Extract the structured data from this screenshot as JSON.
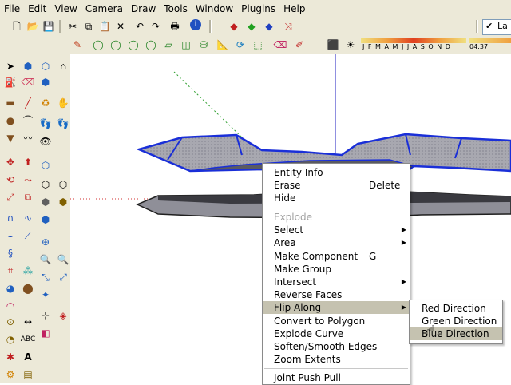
{
  "menu": [
    "File",
    "Edit",
    "View",
    "Camera",
    "Draw",
    "Tools",
    "Window",
    "Plugins",
    "Help"
  ],
  "layer": {
    "label": "La"
  },
  "shadow_months": "J F M A M J J A S O N D",
  "shadow_time": "04:37",
  "context_menu": {
    "items": [
      {
        "label": "Entity Info",
        "shortcut": "",
        "submenu": false,
        "disabled": false
      },
      {
        "label": "Erase",
        "shortcut": "Delete",
        "submenu": false,
        "disabled": false
      },
      {
        "label": "Hide",
        "shortcut": "",
        "submenu": false,
        "disabled": false
      },
      {
        "label": "Explode",
        "shortcut": "",
        "submenu": false,
        "disabled": true
      },
      {
        "label": "Select",
        "shortcut": "",
        "submenu": true,
        "disabled": false
      },
      {
        "label": "Area",
        "shortcut": "",
        "submenu": true,
        "disabled": false
      },
      {
        "label": "Make Component",
        "shortcut": "G",
        "submenu": false,
        "disabled": false
      },
      {
        "label": "Make Group",
        "shortcut": "",
        "submenu": false,
        "disabled": false
      },
      {
        "label": "Intersect",
        "shortcut": "",
        "submenu": true,
        "disabled": false
      },
      {
        "label": "Reverse Faces",
        "shortcut": "",
        "submenu": false,
        "disabled": false
      },
      {
        "label": "Flip Along",
        "shortcut": "",
        "submenu": true,
        "disabled": false,
        "highlighted": true
      },
      {
        "label": "Convert to Polygon",
        "shortcut": "",
        "submenu": false,
        "disabled": false
      },
      {
        "label": "Explode Curve",
        "shortcut": "",
        "submenu": false,
        "disabled": false
      },
      {
        "label": "Soften/Smooth Edges",
        "shortcut": "",
        "submenu": false,
        "disabled": false
      },
      {
        "label": "Zoom Extents",
        "shortcut": "",
        "submenu": false,
        "disabled": false
      },
      {
        "label": "Joint Push Pull",
        "shortcut": "",
        "submenu": false,
        "disabled": false
      }
    ]
  },
  "submenu": {
    "items": [
      {
        "label": "Red Direction",
        "highlighted": false
      },
      {
        "label": "Green Direction",
        "highlighted": false
      },
      {
        "label": "Blue Direction",
        "highlighted": true
      }
    ]
  },
  "colors": {
    "chrome": "#ece9d8",
    "highlight": "#c5c2b0",
    "axis_blue": "#2020c0",
    "axis_red": "#d03030",
    "axis_green": "#30a030",
    "shape_outline": "#1a2fd8",
    "shape_face": "#a8a8ae"
  }
}
